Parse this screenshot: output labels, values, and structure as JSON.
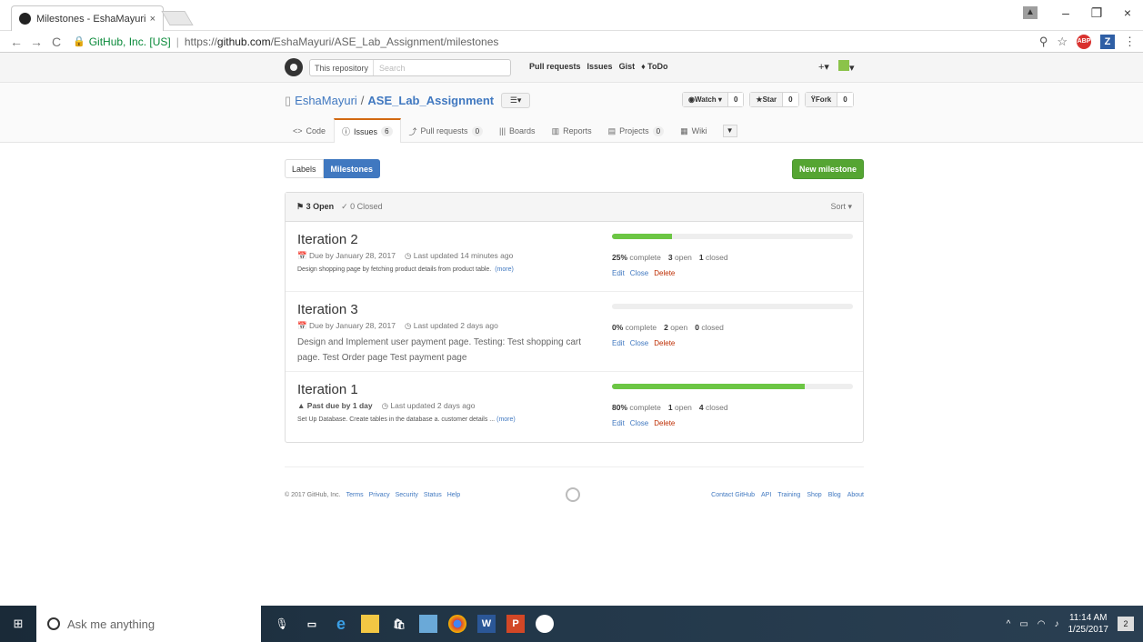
{
  "browser": {
    "tab_title": "Milestones - EshaMayuri",
    "tab_close": "×",
    "back": "←",
    "forward": "→",
    "reload": "C",
    "secure_label": "GitHub, Inc. [US]",
    "url_prefix": "https://",
    "url_domain": "github.com",
    "url_path": "/EshaMayuri/ASE_Lab_Assignment/milestones",
    "window": {
      "minimize": "–",
      "maximize": "❐",
      "close": "×"
    },
    "ext_abp": "ABP",
    "ext_z": "Z",
    "menu": "⋮"
  },
  "header": {
    "search_scope": "This repository",
    "search_placeholder": "Search",
    "nav": [
      "Pull requests",
      "Issues",
      "Gist",
      "ToDo"
    ],
    "plus": "+▾",
    "avatar_caret": "▾"
  },
  "repo": {
    "owner": "EshaMayuri",
    "name": "ASE_Lab_Assignment",
    "watch_label": "Watch ▾",
    "watch_count": "0",
    "star_label": "Star",
    "star_count": "0",
    "fork_label": "Fork",
    "fork_count": "0",
    "tabs": [
      {
        "label": "Code",
        "icon": "<>",
        "count": ""
      },
      {
        "label": "Issues",
        "icon": "ⓘ",
        "count": "6"
      },
      {
        "label": "Pull requests",
        "icon": "⤴",
        "count": "0"
      },
      {
        "label": "Boards",
        "icon": "|||",
        "count": ""
      },
      {
        "label": "Reports",
        "icon": "▥",
        "count": ""
      },
      {
        "label": "Projects",
        "icon": "▤",
        "count": "0"
      },
      {
        "label": "Wiki",
        "icon": "▦",
        "count": ""
      }
    ]
  },
  "subnav": {
    "labels": "Labels",
    "milestones": "Milestones",
    "new_milestone": "New milestone"
  },
  "milestones_header": {
    "open": "3 Open",
    "closed": "0 Closed",
    "sort": "Sort ▾"
  },
  "milestones": [
    {
      "title": "Iteration 2",
      "due": "Due by January 28, 2017",
      "updated": "Last updated 14 minutes ago",
      "description": "Design shopping page by fetching product details from product table.",
      "more": "(more)",
      "progress": 25,
      "percent": "25%",
      "open": "3",
      "closed": "1"
    },
    {
      "title": "Iteration 3",
      "due": "Due by January 28, 2017",
      "updated": "Last updated 2 days ago",
      "description": "Design and Implement user payment page. Testing: Test shopping cart page. Test Order page Test payment page",
      "more": "",
      "progress": 0,
      "percent": "0%",
      "open": "2",
      "closed": "0"
    },
    {
      "title": "Iteration 1",
      "due": "Past due by 1 day",
      "updated": "Last updated 2 days ago",
      "description": "Set Up Database. Create tables in the database a. customer details ...",
      "more": "(more)",
      "progress": 80,
      "percent": "80%",
      "open": "1",
      "closed": "4"
    }
  ],
  "labels": {
    "complete": "complete",
    "open": "open",
    "closed": "closed",
    "edit": "Edit",
    "close": "Close",
    "delete": "Delete"
  },
  "footer": {
    "copyright": "© 2017 GitHub, Inc.",
    "left_links": [
      "Terms",
      "Privacy",
      "Security",
      "Status",
      "Help"
    ],
    "right_links": [
      "Contact GitHub",
      "API",
      "Training",
      "Shop",
      "Blog",
      "About"
    ]
  },
  "taskbar": {
    "search_placeholder": "Ask me anything",
    "apps": [
      "task-view",
      "edge",
      "file-explorer",
      "store",
      "app",
      "chrome",
      "word",
      "powerpoint",
      "github"
    ],
    "time": "11:14 AM",
    "date": "1/25/2017",
    "notifications": "2"
  }
}
